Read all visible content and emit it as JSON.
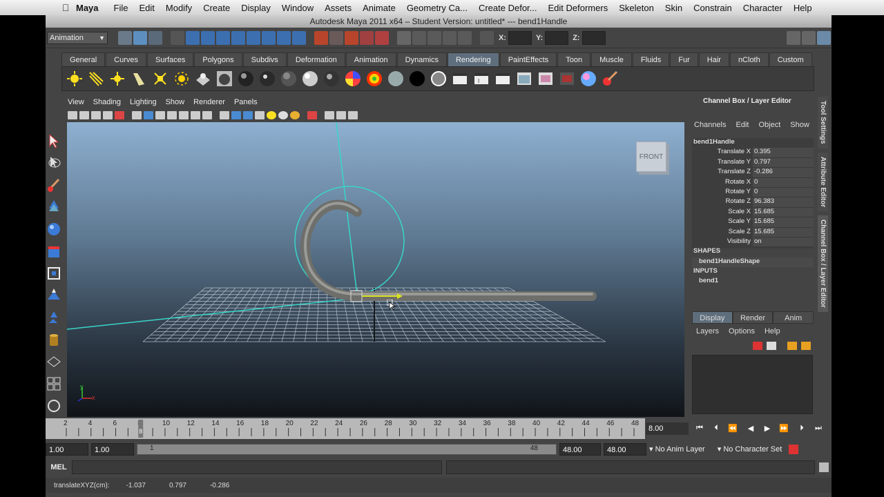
{
  "menubar": {
    "app_name": "Maya",
    "items": [
      "File",
      "Edit",
      "Modify",
      "Create",
      "Display",
      "Window",
      "Assets",
      "Animate",
      "Geometry Ca...",
      "Create Defor...",
      "Edit Deformers",
      "Skeleton",
      "Skin",
      "Constrain",
      "Character",
      "Help"
    ]
  },
  "window": {
    "title": "Autodesk Maya 2011 x64 – Student Version: untitled*   ---   bend1Handle"
  },
  "status_line": {
    "mode": "Animation",
    "x_label": "X:",
    "y_label": "Y:",
    "z_label": "Z:"
  },
  "shelf": {
    "tabs": [
      "General",
      "Curves",
      "Surfaces",
      "Polygons",
      "Subdivs",
      "Deformation",
      "Animation",
      "Dynamics",
      "Rendering",
      "PaintEffects",
      "Toon",
      "Muscle",
      "Fluids",
      "Fur",
      "Hair",
      "nCloth",
      "Custom"
    ],
    "active_tab": "Rendering"
  },
  "viewport": {
    "menu": [
      "View",
      "Shading",
      "Lighting",
      "Show",
      "Renderer",
      "Panels"
    ],
    "view_cube_label": "FRONT",
    "colors": {
      "grid": "#c9d4de",
      "deformer": "#39d6c8",
      "curve": "#7b7b76"
    }
  },
  "channel_box": {
    "title": "Channel Box / Layer Editor",
    "menu": [
      "Channels",
      "Edit",
      "Object",
      "Show"
    ],
    "object": "bend1Handle",
    "channels": [
      {
        "label": "Translate X",
        "value": "0.395"
      },
      {
        "label": "Translate Y",
        "value": "0.797"
      },
      {
        "label": "Translate Z",
        "value": "-0.286"
      },
      {
        "label": "Rotate X",
        "value": "0"
      },
      {
        "label": "Rotate Y",
        "value": "0"
      },
      {
        "label": "Rotate Z",
        "value": "96.383"
      },
      {
        "label": "Scale X",
        "value": "15.685"
      },
      {
        "label": "Scale Y",
        "value": "15.685"
      },
      {
        "label": "Scale Z",
        "value": "15.685"
      },
      {
        "label": "Visibility",
        "value": "on"
      }
    ],
    "shapes_header": "SHAPES",
    "shape": "bend1HandleShape",
    "inputs_header": "INPUTS",
    "input": "bend1",
    "side_tabs": [
      "Tool Settings",
      "Attribute Editor",
      "Channel Box / Layer Editor"
    ]
  },
  "layer_editor": {
    "tabs": [
      "Display",
      "Render",
      "Anim"
    ],
    "menu": [
      "Layers",
      "Options",
      "Help"
    ]
  },
  "time_slider": {
    "ticks": [
      "2",
      "4",
      "6",
      "8",
      "10",
      "12",
      "14",
      "16",
      "18",
      "20",
      "22",
      "24",
      "26",
      "28",
      "30",
      "32",
      "34",
      "36",
      "38",
      "40",
      "42",
      "44",
      "46",
      "48"
    ],
    "current_frame": "8.00",
    "current_marker": "8"
  },
  "range_slider": {
    "start": "1.00",
    "anim_start": "1.00",
    "range_start": "1",
    "range_end": "48",
    "anim_end": "48.00",
    "end": "48.00",
    "anim_layer": "No Anim Layer",
    "character_set": "No Character Set"
  },
  "command_line": {
    "label": "MEL"
  },
  "help_line": {
    "label": "translateXYZ(cm):",
    "x": "-1.037",
    "y": "0.797",
    "z": "-0.286"
  }
}
